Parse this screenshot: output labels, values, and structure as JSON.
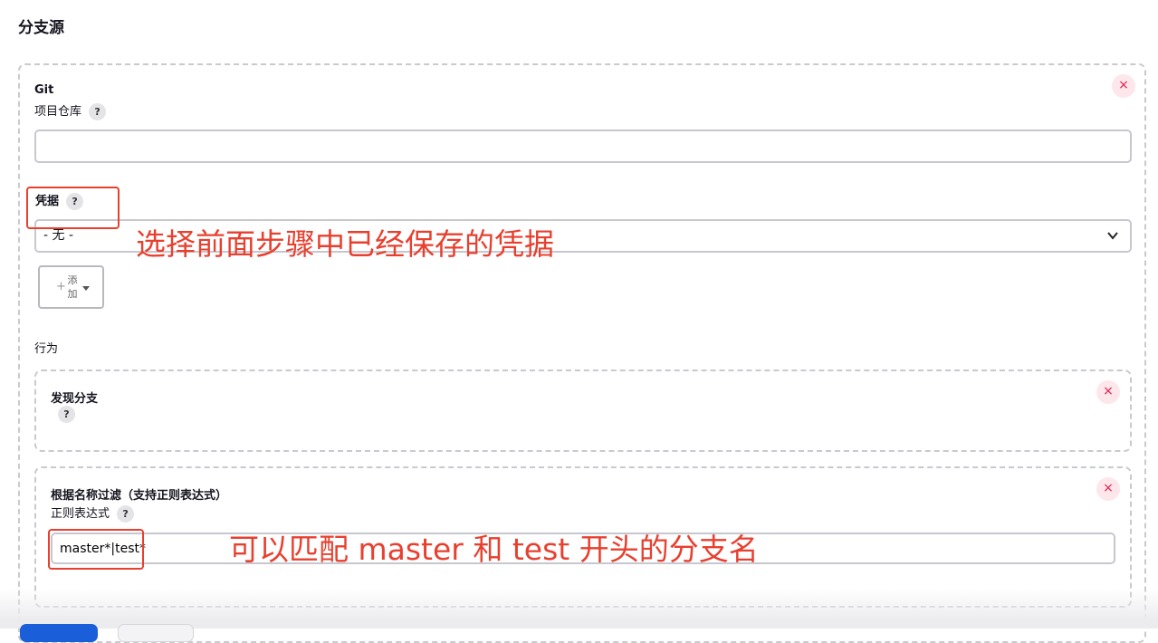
{
  "section": {
    "title": "分支源"
  },
  "git": {
    "title": "Git",
    "repo_label": "项目仓库",
    "repo_value": "",
    "help_glyph": "?",
    "credentials_label": "凭据",
    "credentials_selected": "- 无 -",
    "add_label_line1": "添",
    "add_label_line2": "加",
    "add_plus": "+",
    "remove_glyph": "×"
  },
  "behaviors": {
    "label": "行为",
    "discover_branches": {
      "title": "发现分支"
    },
    "name_filter": {
      "title": "根据名称过滤（支持正则表达式）",
      "regex_label": "正则表达式",
      "regex_value": "master*|test*"
    }
  },
  "annotations": {
    "credentials_note": "选择前面步骤中已经保存的凭据",
    "regex_note": "可以匹配 master 和 test 开头的分支名",
    "color": "#e8402f"
  },
  "colors": {
    "remove_bg": "#fde7ea",
    "remove_fg": "#e6194b",
    "primary": "#1a5fd9"
  }
}
